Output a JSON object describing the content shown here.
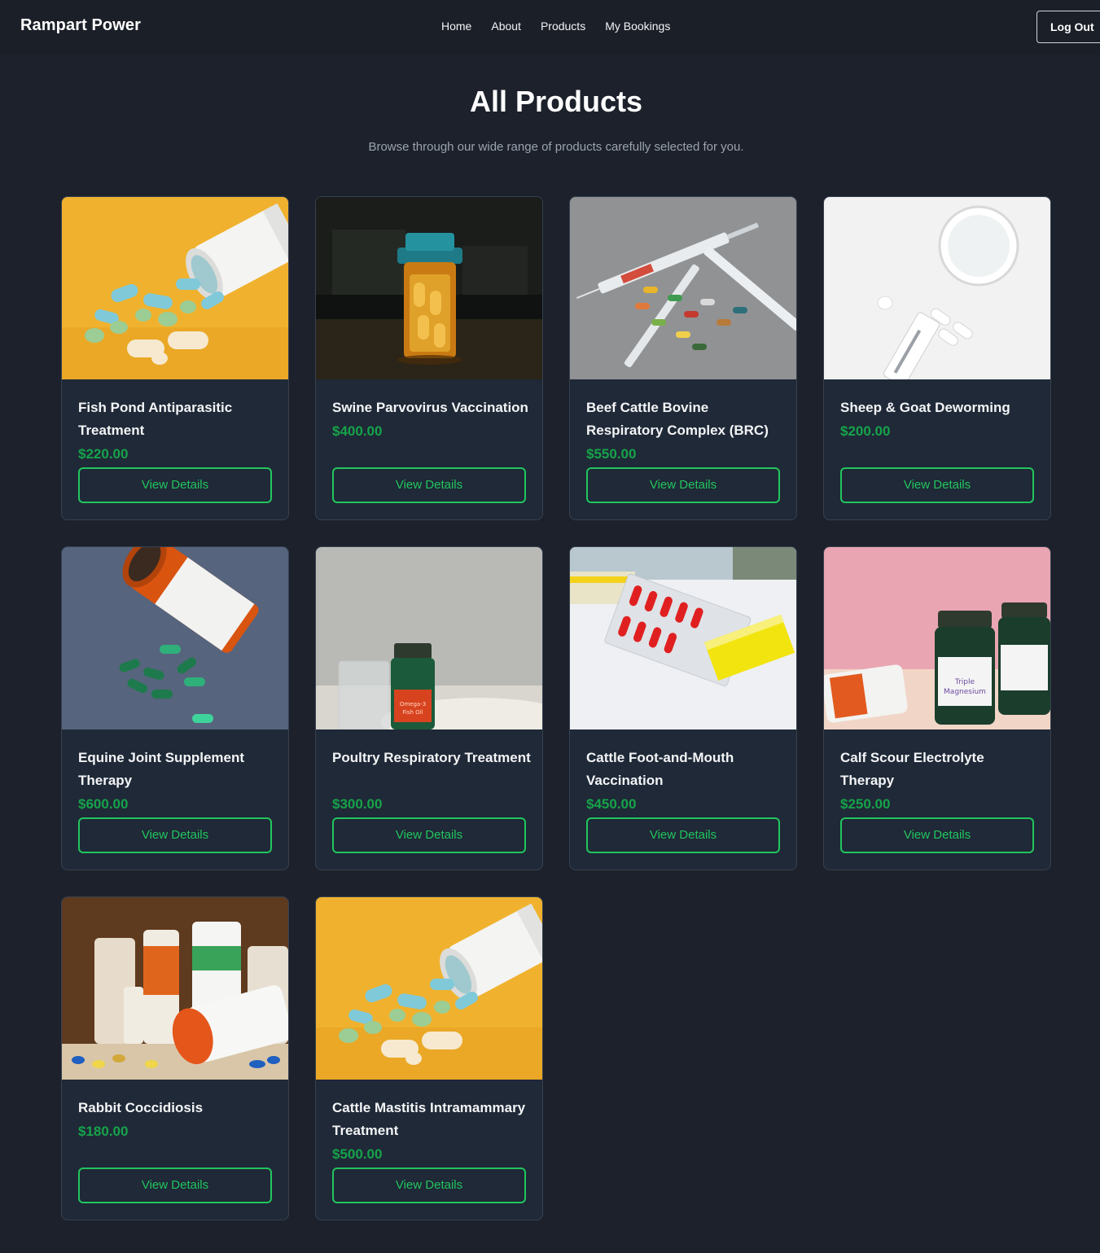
{
  "nav": {
    "brand": "Rampart Power",
    "links": [
      "Home",
      "About",
      "Products",
      "My Bookings"
    ],
    "logout": "Log Out"
  },
  "header": {
    "title": "All Products",
    "subtitle": "Browse through our wide range of products carefully selected for you."
  },
  "button_label": "View Details",
  "colors": {
    "background": "#1c212b",
    "card": "#1f2937",
    "accent": "#22c55e",
    "price": "#16a34a"
  },
  "products": [
    {
      "name": "Fish Pond Antiparasitic Treatment",
      "price": "$220.00",
      "image": "pills-spilled-yellow"
    },
    {
      "name": "Swine Parvovirus Vaccination",
      "price": "$400.00",
      "image": "amber-pill-bottle-dark"
    },
    {
      "name": "Beef Cattle Bovine Respiratory Complex (BRC)",
      "price": "$550.00",
      "image": "syringes-and-capsules"
    },
    {
      "name": "Sheep & Goat Deworming",
      "price": "$200.00",
      "image": "glass-and-white-pills"
    },
    {
      "name": "Equine Joint Supplement Therapy",
      "price": "$600.00",
      "image": "orange-bottle-green-capsules"
    },
    {
      "name": "Poultry Respiratory Treatment",
      "price": "$300.00",
      "image": "omega-3-bottle"
    },
    {
      "name": "Cattle Foot-and-Mouth Vaccination",
      "price": "$450.00",
      "image": "red-capsule-blister"
    },
    {
      "name": "Calf Scour Electrolyte Therapy",
      "price": "$250.00",
      "image": "magnesium-bottles-pink"
    },
    {
      "name": "Rabbit Coccidiosis",
      "price": "$180.00",
      "image": "supplement-bottles-shelf"
    },
    {
      "name": "Cattle Mastitis Intramammary Treatment",
      "price": "$500.00",
      "image": "pills-spilled-yellow"
    }
  ]
}
